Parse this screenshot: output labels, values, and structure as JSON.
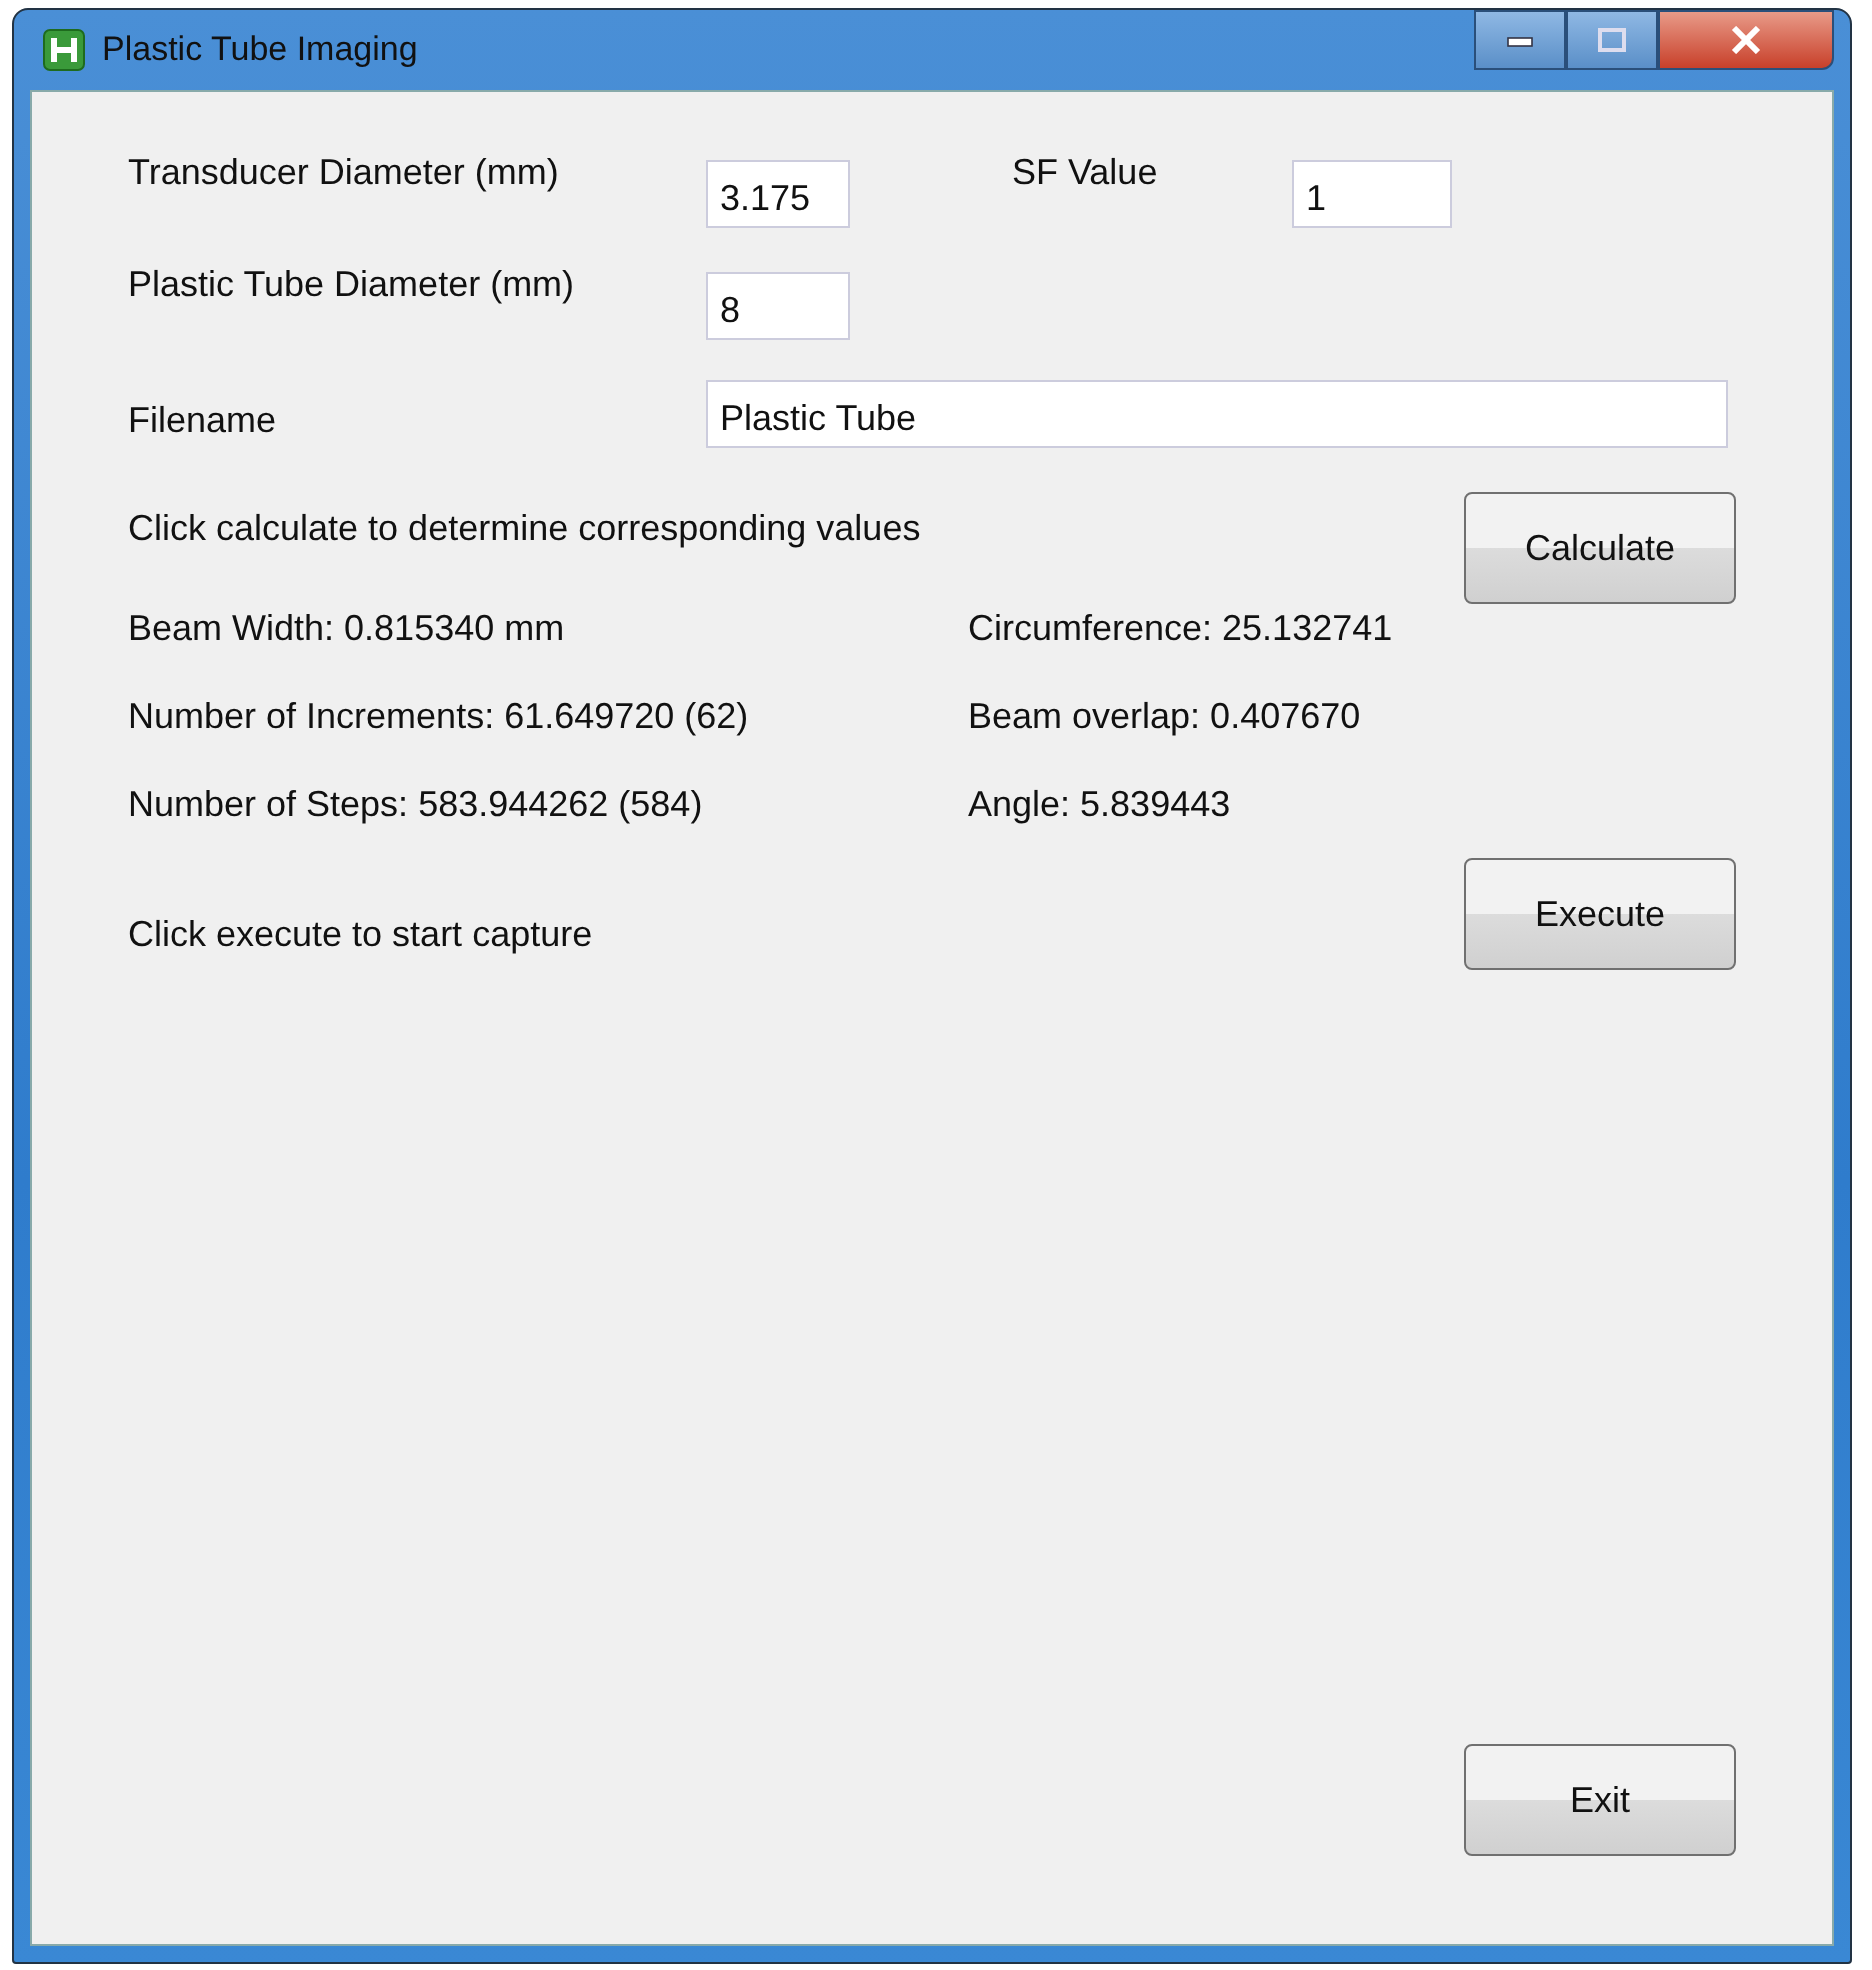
{
  "window": {
    "title": "Plastic Tube Imaging"
  },
  "inputs": [
    {
      "label": "Transducer Diameter (mm)",
      "value": "3.175"
    },
    {
      "label": "SF Value",
      "value": "1"
    },
    {
      "label": "Plastic Tube Diameter (mm)",
      "value": "8"
    },
    {
      "label": "Filename",
      "value": "Plastic Tube"
    }
  ],
  "calculate": {
    "prompt": "Click calculate to determine corresponding values",
    "button": "Calculate"
  },
  "results": [
    {
      "left": "Beam Width: 0.815340 mm",
      "right": "Circumference: 25.132741"
    },
    {
      "left": "Number of Increments: 61.649720 (62)",
      "right": "Beam overlap: 0.407670"
    },
    {
      "left": "Number of Steps: 583.944262 (584)",
      "right": "Angle: 5.839443"
    }
  ],
  "execute": {
    "prompt": "Click execute to start capture",
    "button": "Execute"
  },
  "exit_button": "Exit"
}
